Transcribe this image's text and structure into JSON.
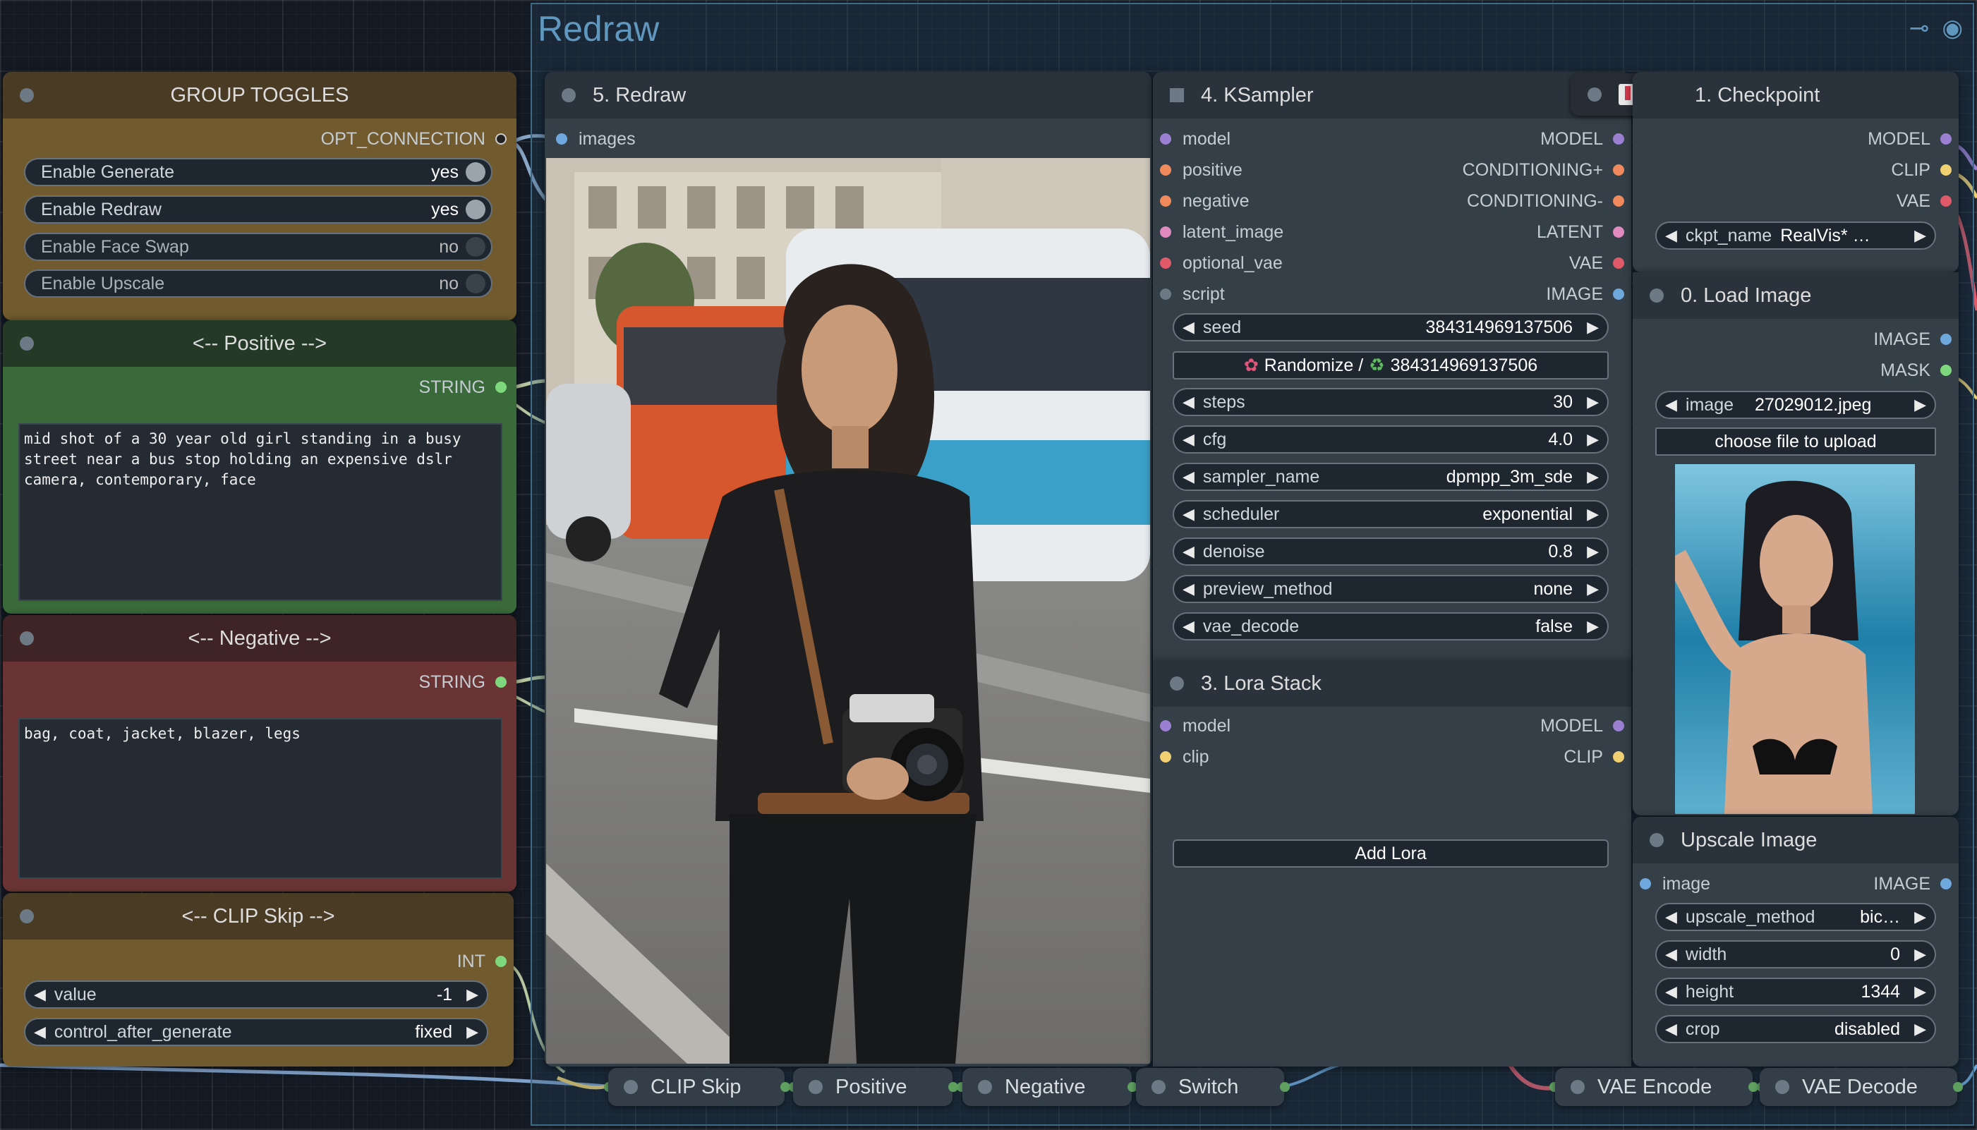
{
  "group": {
    "title": "Redraw"
  },
  "toggles": {
    "title": "GROUP TOGGLES",
    "output": "OPT_CONNECTION",
    "items": [
      {
        "label": "Enable Generate",
        "value": "yes"
      },
      {
        "label": "Enable Redraw",
        "value": "yes"
      },
      {
        "label": "Enable Face Swap",
        "value": "no"
      },
      {
        "label": "Enable Upscale",
        "value": "no"
      }
    ]
  },
  "positive": {
    "title": "<--  Positive  -->",
    "output": "STRING",
    "text": "mid shot of a 30 year old girl standing in a busy street near a bus stop holding an expensive dslr camera, contemporary, face"
  },
  "negative": {
    "title": "<--  Negative  -->",
    "output": "STRING",
    "text": "bag, coat, jacket, blazer, legs"
  },
  "clipskip": {
    "title": "<--  CLIP Skip  -->",
    "output": "INT",
    "value_label": "value",
    "value": "-1",
    "cag_label": "control_after_generate",
    "cag_value": "fixed"
  },
  "redraw": {
    "title": "5. Redraw",
    "input": "images"
  },
  "ksampler": {
    "title": "4. KSampler",
    "inputs": [
      "model",
      "positive",
      "negative",
      "latent_image",
      "optional_vae",
      "script"
    ],
    "outputs": [
      "MODEL",
      "CONDITIONING+",
      "CONDITIONING-",
      "LATENT",
      "VAE",
      "IMAGE"
    ],
    "seed_label": "seed",
    "seed": "384314969137506",
    "randomize_label": "Randomize /",
    "randomize_seed": "384314969137506",
    "widgets": [
      {
        "label": "steps",
        "value": "30"
      },
      {
        "label": "cfg",
        "value": "4.0"
      },
      {
        "label": "sampler_name",
        "value": "dpmpp_3m_sde"
      },
      {
        "label": "scheduler",
        "value": "exponential"
      },
      {
        "label": "denoise",
        "value": "0.8"
      },
      {
        "label": "preview_method",
        "value": "none"
      },
      {
        "label": "vae_decode",
        "value": "false"
      }
    ]
  },
  "lora": {
    "title": "3. Lora Stack",
    "inputs": [
      "model",
      "clip"
    ],
    "outputs": [
      "MODEL",
      "CLIP"
    ],
    "button": "Add Lora"
  },
  "checkpoint": {
    "title": "1. Checkpoint",
    "outputs": [
      "MODEL",
      "CLIP",
      "VAE"
    ],
    "ckpt_label": "ckpt_name",
    "ckpt_value": "RealVis* …"
  },
  "loadimage": {
    "title": "0. Load Image",
    "outputs": [
      "IMAGE",
      "MASK"
    ],
    "image_label": "image",
    "image_value": "27029012.jpeg",
    "upload": "choose file to upload"
  },
  "upscale": {
    "title": "Upscale Image",
    "input": "image",
    "output": "IMAGE",
    "widgets": [
      {
        "label": "upscale_method",
        "value": "bic…"
      },
      {
        "label": "width",
        "value": "0"
      },
      {
        "label": "height",
        "value": "1344"
      },
      {
        "label": "crop",
        "value": "disabled"
      }
    ]
  },
  "bottom": [
    "CLIP Skip",
    "Positive",
    "Negative",
    "Switch",
    "VAE Encode",
    "VAE Decode"
  ],
  "colors": {
    "model": "#9b7fd0",
    "clip": "#f0d070",
    "vae": "#e05a6a",
    "image": "#6fa8dc",
    "conditioning": "#f08a5d",
    "latent": "#e08ac0",
    "string": "#7dd87d"
  }
}
